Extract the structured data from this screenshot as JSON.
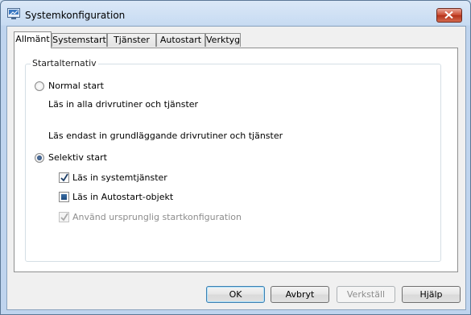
{
  "window": {
    "title": "Systemkonfiguration"
  },
  "tabs": [
    {
      "label": "Allmänt",
      "active": true
    },
    {
      "label": "Systemstart",
      "active": false
    },
    {
      "label": "Tjänster",
      "active": false
    },
    {
      "label": "Autostart",
      "active": false
    },
    {
      "label": "Verktyg",
      "active": false
    }
  ],
  "startup": {
    "group_label": "Startalternativ",
    "normal": {
      "label": "Normal start",
      "description": "Läs in alla drivrutiner och tjänster",
      "selected": false
    },
    "diagnostic": {
      "description": "Läs endast in grundläggande drivrutiner och tjänster"
    },
    "selective": {
      "label": "Selektiv start",
      "selected": true,
      "options": [
        {
          "label": "Läs in systemtjänster",
          "state": "checked",
          "enabled": true
        },
        {
          "label": "Läs in Autostart-objekt",
          "state": "indeterminate",
          "enabled": true
        },
        {
          "label": "Använd ursprunglig startkonfiguration",
          "state": "checked",
          "enabled": false
        }
      ]
    }
  },
  "buttons": {
    "ok": "OK",
    "cancel": "Avbryt",
    "apply": "Verkställ",
    "help": "Hjälp"
  },
  "colors": {
    "title_bar": "#c7dbf2",
    "close_button": "#c9462c",
    "default_button_border": "#3c7fb1"
  }
}
